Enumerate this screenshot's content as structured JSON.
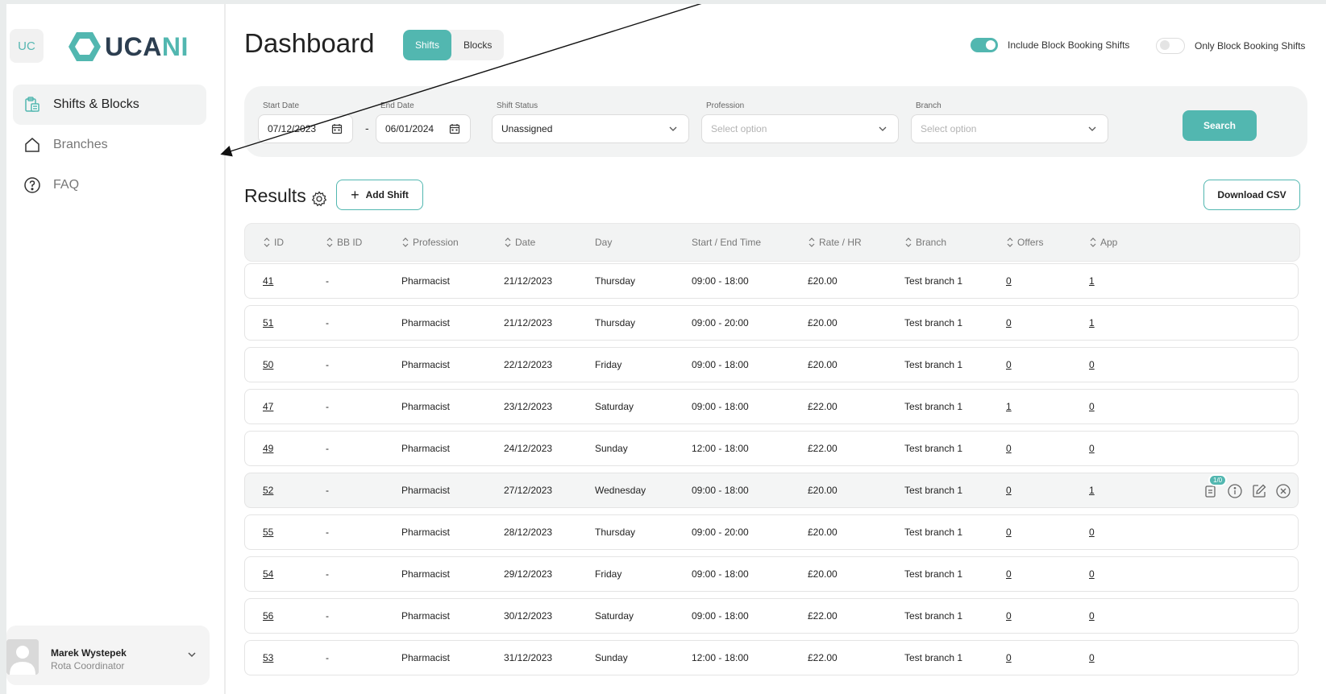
{
  "sidebar": {
    "badge": "UC",
    "logo": {
      "prefix": "UCA",
      "suffix": "NI"
    },
    "items": [
      {
        "label": "Shifts & Blocks",
        "icon": "clipboard-icon",
        "active": true
      },
      {
        "label": "Branches",
        "icon": "home-icon",
        "active": false
      },
      {
        "label": "FAQ",
        "icon": "help-circle-icon",
        "active": false
      }
    ],
    "user": {
      "name": "Marek Wystepek",
      "role": "Rota Coordinator"
    }
  },
  "header": {
    "title": "Dashboard",
    "tabs": [
      "Shifts",
      "Blocks"
    ],
    "active_tab": "Shifts",
    "toggles": [
      {
        "label": "Include Block Booking Shifts",
        "on": true
      },
      {
        "label": "Only Block Booking Shifts",
        "on": false
      }
    ]
  },
  "filters": {
    "start_date": {
      "label": "Start Date",
      "value": "07/12/2023"
    },
    "end_date": {
      "label": "End Date",
      "value": "06/01/2024"
    },
    "dash": "-",
    "shift_status": {
      "label": "Shift Status",
      "value": "Unassigned"
    },
    "profession": {
      "label": "Profession",
      "placeholder": "Select option"
    },
    "branch": {
      "label": "Branch",
      "placeholder": "Select option"
    },
    "search_label": "Search"
  },
  "results": {
    "title": "Results",
    "add_label": "Add Shift",
    "csv_label": "Download CSV",
    "columns": [
      "ID",
      "BB ID",
      "Profession",
      "Date",
      "Day",
      "Start / End Time",
      "Rate / HR",
      "Branch",
      "Offers",
      "App"
    ],
    "rows": [
      {
        "id": "41",
        "bbid": "-",
        "profession": "Pharmacist",
        "date": "21/12/2023",
        "day": "Thursday",
        "time": "09:00 - 18:00",
        "rate": "£20.00",
        "branch": "Test branch 1",
        "offers": "0",
        "app": "1"
      },
      {
        "id": "51",
        "bbid": "-",
        "profession": "Pharmacist",
        "date": "21/12/2023",
        "day": "Thursday",
        "time": "09:00 - 20:00",
        "rate": "£20.00",
        "branch": "Test branch 1",
        "offers": "0",
        "app": "1"
      },
      {
        "id": "50",
        "bbid": "-",
        "profession": "Pharmacist",
        "date": "22/12/2023",
        "day": "Friday",
        "time": "09:00 - 18:00",
        "rate": "£20.00",
        "branch": "Test branch 1",
        "offers": "0",
        "app": "0"
      },
      {
        "id": "47",
        "bbid": "-",
        "profession": "Pharmacist",
        "date": "23/12/2023",
        "day": "Saturday",
        "time": "09:00 - 18:00",
        "rate": "£22.00",
        "branch": "Test branch 1",
        "offers": "1",
        "app": "0"
      },
      {
        "id": "49",
        "bbid": "-",
        "profession": "Pharmacist",
        "date": "24/12/2023",
        "day": "Sunday",
        "time": "12:00 - 18:00",
        "rate": "£22.00",
        "branch": "Test branch 1",
        "offers": "0",
        "app": "0"
      },
      {
        "id": "52",
        "bbid": "-",
        "profession": "Pharmacist",
        "date": "27/12/2023",
        "day": "Wednesday",
        "time": "09:00 - 18:00",
        "rate": "£20.00",
        "branch": "Test branch 1",
        "offers": "0",
        "app": "1",
        "hover": true,
        "badge": "1/0"
      },
      {
        "id": "55",
        "bbid": "-",
        "profession": "Pharmacist",
        "date": "28/12/2023",
        "day": "Thursday",
        "time": "09:00 - 20:00",
        "rate": "£20.00",
        "branch": "Test branch 1",
        "offers": "0",
        "app": "0"
      },
      {
        "id": "54",
        "bbid": "-",
        "profession": "Pharmacist",
        "date": "29/12/2023",
        "day": "Friday",
        "time": "09:00 - 18:00",
        "rate": "£20.00",
        "branch": "Test branch 1",
        "offers": "0",
        "app": "0"
      },
      {
        "id": "56",
        "bbid": "-",
        "profession": "Pharmacist",
        "date": "30/12/2023",
        "day": "Saturday",
        "time": "09:00 - 18:00",
        "rate": "£22.00",
        "branch": "Test branch 1",
        "offers": "0",
        "app": "0"
      },
      {
        "id": "53",
        "bbid": "-",
        "profession": "Pharmacist",
        "date": "31/12/2023",
        "day": "Sunday",
        "time": "12:00 - 18:00",
        "rate": "£22.00",
        "branch": "Test branch 1",
        "offers": "0",
        "app": "0"
      }
    ]
  },
  "colors": {
    "accent": "#52b7b0",
    "navy": "#2c3e50"
  }
}
